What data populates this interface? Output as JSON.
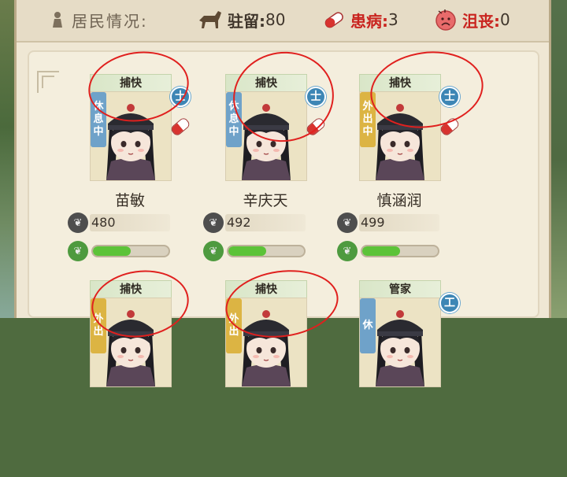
{
  "header": {
    "title": "居民情况:",
    "garrison_label": "驻留:",
    "garrison_value": "80",
    "sick_label": "患病:",
    "sick_value": "3",
    "depressed_label": "沮丧:",
    "depressed_value": "0",
    "icons": [
      "person-icon",
      "horse-icon",
      "pill-icon",
      "sad-face-icon"
    ]
  },
  "colors": {
    "health_fill": "#5cc338",
    "rank_badge": "#3d86b5",
    "rest_tag": "#6fa2c9",
    "out_tag": "#dcb443",
    "annotation": "#e0201e"
  },
  "residents": [
    {
      "job": "捕快",
      "status": "休息中",
      "rank": "士",
      "name": "苗敏",
      "value": "480",
      "health": 0.5
    },
    {
      "job": "捕快",
      "status": "休息中",
      "rank": "士",
      "name": "辛庆天",
      "value": "492",
      "health": 0.5
    },
    {
      "job": "捕快",
      "status": "外出中",
      "rank": "士",
      "name": "慎涵润",
      "value": "499",
      "health": 0.5
    },
    {
      "job": "捕快",
      "status": "外出",
      "rank": "",
      "name": "",
      "value": "",
      "health": 0
    },
    {
      "job": "捕快",
      "status": "外出",
      "rank": "",
      "name": "",
      "value": "",
      "health": 0
    },
    {
      "job": "管家",
      "status": "休",
      "rank": "工",
      "name": "",
      "value": "",
      "health": 0
    }
  ]
}
